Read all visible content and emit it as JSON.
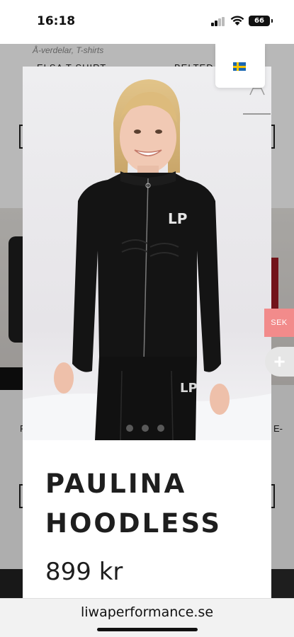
{
  "status_bar": {
    "time": "16:18",
    "battery": "66"
  },
  "background_page": {
    "category": "Å-verdelar, T-shirts",
    "product_left": "ELSA T-SHIRT",
    "product_right": "BELTED …T",
    "row2_left_fragment": "P",
    "row2_right_fragment": "E-"
  },
  "language": {
    "flag_icon": "sweden-flag-icon"
  },
  "modal": {
    "close_icon": "close-icon",
    "title": "PAULINA HOODLESS",
    "price": "899 kr",
    "image": {
      "logo": "LP",
      "image_count": 3,
      "active_index": 0
    }
  },
  "side": {
    "currency_label": "SEK",
    "add_icon": "plus-icon"
  },
  "browser": {
    "url": "liwaperformance.se"
  },
  "colors": {
    "currency_tab": "#f28b8b",
    "text": "#1e1e1e",
    "flag_blue": "#1b67b1",
    "flag_yellow": "#f6c400"
  }
}
